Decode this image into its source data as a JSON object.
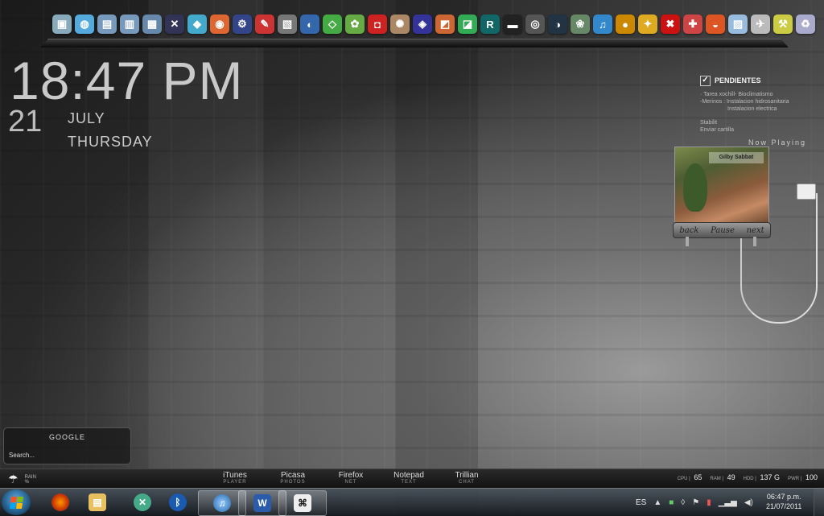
{
  "dock": {
    "icons": [
      {
        "name": "computer-icon",
        "glyph": "▣",
        "color": "#8ab"
      },
      {
        "name": "network-icon",
        "glyph": "◍",
        "color": "#5ad"
      },
      {
        "name": "folder-icon",
        "glyph": "▤",
        "color": "#79b"
      },
      {
        "name": "folder-open-icon",
        "glyph": "▥",
        "color": "#79b"
      },
      {
        "name": "documents-icon",
        "glyph": "▦",
        "color": "#68a"
      },
      {
        "name": "tools-icon",
        "glyph": "✕",
        "color": "#335"
      },
      {
        "name": "box-icon",
        "glyph": "◆",
        "color": "#4ac"
      },
      {
        "name": "firefox-icon",
        "glyph": "◉",
        "color": "#d63"
      },
      {
        "name": "utility-icon",
        "glyph": "⚙",
        "color": "#348"
      },
      {
        "name": "pen-icon",
        "glyph": "✎",
        "color": "#c33"
      },
      {
        "name": "calendar-icon",
        "glyph": "▧",
        "color": "#777"
      },
      {
        "name": "globe-icon",
        "glyph": "◐",
        "color": "#36a"
      },
      {
        "name": "gem-icon",
        "glyph": "◇",
        "color": "#4a4"
      },
      {
        "name": "paint-icon",
        "glyph": "✿",
        "color": "#6a4"
      },
      {
        "name": "camera-icon",
        "glyph": "◘",
        "color": "#c22"
      },
      {
        "name": "palette-icon",
        "glyph": "✺",
        "color": "#a86"
      },
      {
        "name": "media-icon",
        "glyph": "◈",
        "color": "#339"
      },
      {
        "name": "office-icon",
        "glyph": "◩",
        "color": "#c63"
      },
      {
        "name": "chart-icon",
        "glyph": "◪",
        "color": "#3a5"
      },
      {
        "name": "reader-icon",
        "glyph": "R",
        "color": "#166"
      },
      {
        "name": "terminal-icon",
        "glyph": "▬",
        "color": "#222"
      },
      {
        "name": "halo-icon",
        "glyph": "◎",
        "color": "#555"
      },
      {
        "name": "steam-icon",
        "glyph": "◑",
        "color": "#234"
      },
      {
        "name": "flower-icon",
        "glyph": "❀",
        "color": "#686"
      },
      {
        "name": "itunes-icon",
        "glyph": "♫",
        "color": "#38c"
      },
      {
        "name": "disc-icon",
        "glyph": "●",
        "color": "#c80"
      },
      {
        "name": "jamaica-icon",
        "glyph": "✦",
        "color": "#da2"
      },
      {
        "name": "x-icon",
        "glyph": "✖",
        "color": "#c11"
      },
      {
        "name": "game-icon",
        "glyph": "✚",
        "color": "#c44"
      },
      {
        "name": "browser-icon",
        "glyph": "◒",
        "color": "#d52"
      },
      {
        "name": "notes-icon",
        "glyph": "▨",
        "color": "#9bd"
      },
      {
        "name": "map-icon",
        "glyph": "✈",
        "color": "#bbb"
      },
      {
        "name": "hammer-icon",
        "glyph": "⚒",
        "color": "#cc4"
      },
      {
        "name": "recycle-bin-icon",
        "glyph": "♻",
        "color": "#aac"
      }
    ]
  },
  "clock": {
    "time": "18:47 PM",
    "day": "21",
    "month": "JULY",
    "weekday": "THURSDAY"
  },
  "todo": {
    "title": "PENDIENTES",
    "lines": [
      "· Tarea xochill- Bioclimatismo",
      "-Merinos : Instalacion hidrosanitaria"
    ],
    "indent_line": "Instalacion electrica",
    "extra": [
      "Stabilit",
      "Enviar cartilla"
    ]
  },
  "now_playing": {
    "label": "Now Playing",
    "album_band": "Gilby Sabbat",
    "back": "back",
    "pause": "Pause",
    "next": "next"
  },
  "google": {
    "title": "GOOGLE",
    "placeholder": "Search..."
  },
  "weather": {
    "label": "RAIN",
    "unit": "%"
  },
  "launchers": [
    {
      "name": "iTunes",
      "sub": "PLAYER"
    },
    {
      "name": "Picasa",
      "sub": "PHOTOS"
    },
    {
      "name": "Firefox",
      "sub": "NET"
    },
    {
      "name": "Notepad",
      "sub": "TEXT"
    },
    {
      "name": "Trillian",
      "sub": "CHAT"
    }
  ],
  "stats": [
    {
      "label": "CPU",
      "value": "65"
    },
    {
      "label": "RAM",
      "value": "49"
    },
    {
      "label": "HDD",
      "value": "137 G"
    },
    {
      "label": "PWR",
      "value": "100"
    }
  ],
  "taskbar": {
    "lang": "ES",
    "time": "06:47 p.m.",
    "date": "21/07/2011"
  },
  "colors": {
    "accent": "#3d7fb8",
    "text": "#cccccc"
  }
}
